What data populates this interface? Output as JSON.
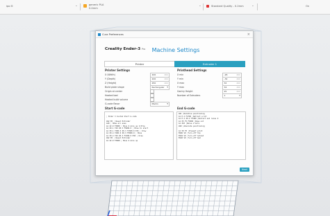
{
  "toolbar": {
    "left_text": "ipo ⊟",
    "printer_name": "generic PLA",
    "printer_sub": "0.4mm",
    "profile": "Standard Quality - 0.2mm",
    "extra": "On"
  },
  "dialog": {
    "title": "Cura Preferences",
    "machine_name": "Creality Ender-3",
    "machine_sub": "Pro",
    "heading": "Machine Settings",
    "tabs": [
      "Printer",
      "Extruder 1"
    ],
    "printer_settings": {
      "title": "Printer Settings",
      "rows": [
        {
          "label": "X (Width)",
          "value": "220",
          "unit": "mm"
        },
        {
          "label": "Y (Depth)",
          "value": "220",
          "unit": "mm"
        },
        {
          "label": "Z (Height)",
          "value": "250",
          "unit": "mm"
        },
        {
          "label": "Build plate shape",
          "value": "Rectangular"
        },
        {
          "label": "Origin at center"
        },
        {
          "label": "Heated bed"
        },
        {
          "label": "Heated build volume"
        },
        {
          "label": "G-code flavor",
          "value": "Marlin"
        }
      ]
    },
    "printhead_settings": {
      "title": "Printhead Settings",
      "rows": [
        {
          "label": "X min",
          "value": "-26",
          "unit": "mm"
        },
        {
          "label": "Y min",
          "value": "-32",
          "unit": "mm"
        },
        {
          "label": "X max",
          "value": "32",
          "unit": "mm"
        },
        {
          "label": "Y max",
          "value": "34",
          "unit": "mm"
        },
        {
          "label": "Gantry Height",
          "value": "25",
          "unit": "mm"
        },
        {
          "label": "Number of Extruders",
          "value": "1"
        }
      ]
    },
    "start_gcode": {
      "title": "Start G-code",
      "lines": [
        "",
        "; Ender 3 Custom Start G-code",
        "",
        "G92 E0 ; Reset Extruder",
        "G28 ; Home all axes",
        "G1 Z2.0 F3000 ; Move Z Axis up little",
        "G1 X0.1 Y20 Z0.3 F5000.0 ; Move to start",
        "G1 X0.1 Y200.0 Z0.3 F1500.0 E15 ; Draw",
        "G1 X0.4 Y200.0 Z0.3 F5000.0 ; Move",
        "G1 X0.4 Y20 Z0.3 F1500.0 E30 ; Draw",
        "G92 E0 ; Reset Extruder",
        "G1 Z2.0 F3000 ; Move Z Axis up"
      ]
    },
    "end_gcode": {
      "title": "End G-code",
      "lines": [
        "G91 ;Relative positioning",
        "G1 E-2 F2700 ;Retract a bit",
        "G1 E-2 Z0.2 F2400 ;Retract and raise Z",
        "G1 X5 Y5 F3000 ;Wipe out",
        "G1 Z10 ;Raise Z more",
        "G90 ;Absolute positioning",
        "",
        "G1 X0 Y0 ;Present print",
        "M106 S0 ;Turn-off fan",
        "M104 S0 ;Turn-off hotend",
        "M140 S0 ;Turn-off bed"
      ]
    },
    "next_label": "Next"
  },
  "colors": {
    "accent": "#2aa0c0",
    "heading": "#1a86c8"
  }
}
